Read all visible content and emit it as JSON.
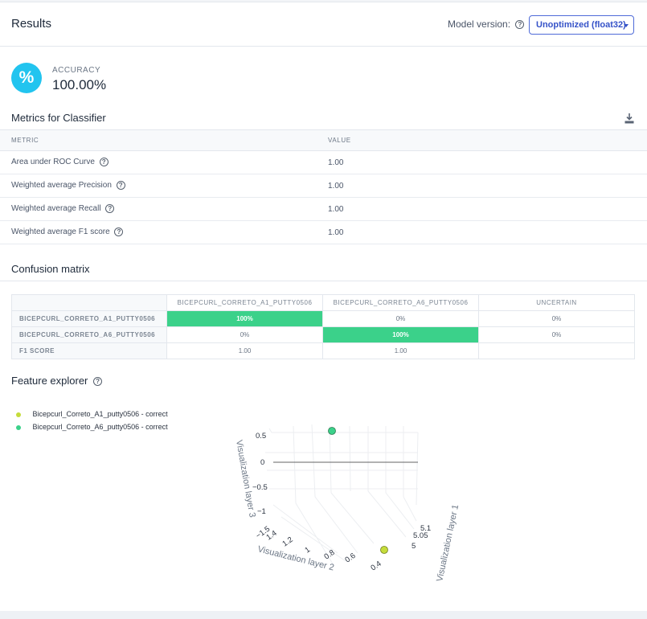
{
  "header": {
    "title": "Results",
    "model_label": "Model version:",
    "model_value": "Unoptimized (float32)"
  },
  "accuracy": {
    "icon": "%",
    "label": "ACCURACY",
    "value": "100.00%"
  },
  "metrics": {
    "title": "Metrics for Classifier",
    "col_metric": "METRIC",
    "col_value": "VALUE",
    "rows": [
      {
        "name": "Area under ROC Curve",
        "value": "1.00"
      },
      {
        "name": "Weighted average Precision",
        "value": "1.00"
      },
      {
        "name": "Weighted average Recall",
        "value": "1.00"
      },
      {
        "name": "Weighted average F1 score",
        "value": "1.00"
      }
    ]
  },
  "confusion": {
    "title": "Confusion matrix",
    "columns": [
      "BICEPCURL_CORRETO_A1_PUTTY0506",
      "BICEPCURL_CORRETO_A6_PUTTY0506",
      "UNCERTAIN"
    ],
    "rows": [
      {
        "label": "BICEPCURL_CORRETO_A1_PUTTY0506",
        "cells": [
          "100%",
          "0%",
          "0%"
        ]
      },
      {
        "label": "BICEPCURL_CORRETO_A6_PUTTY0506",
        "cells": [
          "0%",
          "100%",
          "0%"
        ]
      },
      {
        "label": "F1 SCORE",
        "cells": [
          "1.00",
          "1.00",
          ""
        ]
      }
    ]
  },
  "feature_explorer": {
    "title": "Feature explorer",
    "legend": [
      {
        "label": "Bicepcurl_Correto_A1_putty0506 - correct",
        "color": "#c5dc3a"
      },
      {
        "label": "Bicepcurl_Correto_A6_putty0506 - correct",
        "color": "#3bd18a"
      }
    ],
    "axis_layer3": "Visualization layer 3",
    "axis_layer2": "Visualization layer 2",
    "axis_layer1": "Visualization layer 1",
    "z_ticks": [
      "0.5",
      "0",
      "−0.5",
      "−1"
    ],
    "y_ticks": [
      "1.4",
      "1.2",
      "1",
      "0.8",
      "0.6",
      "0.4"
    ],
    "y_tick_extra": "−1.5",
    "x_ticks": [
      "5.1",
      "5.05",
      "5"
    ]
  },
  "colors": {
    "accent": "#3552c8",
    "badge": "#22c4ef",
    "match": "#3bd18a"
  }
}
